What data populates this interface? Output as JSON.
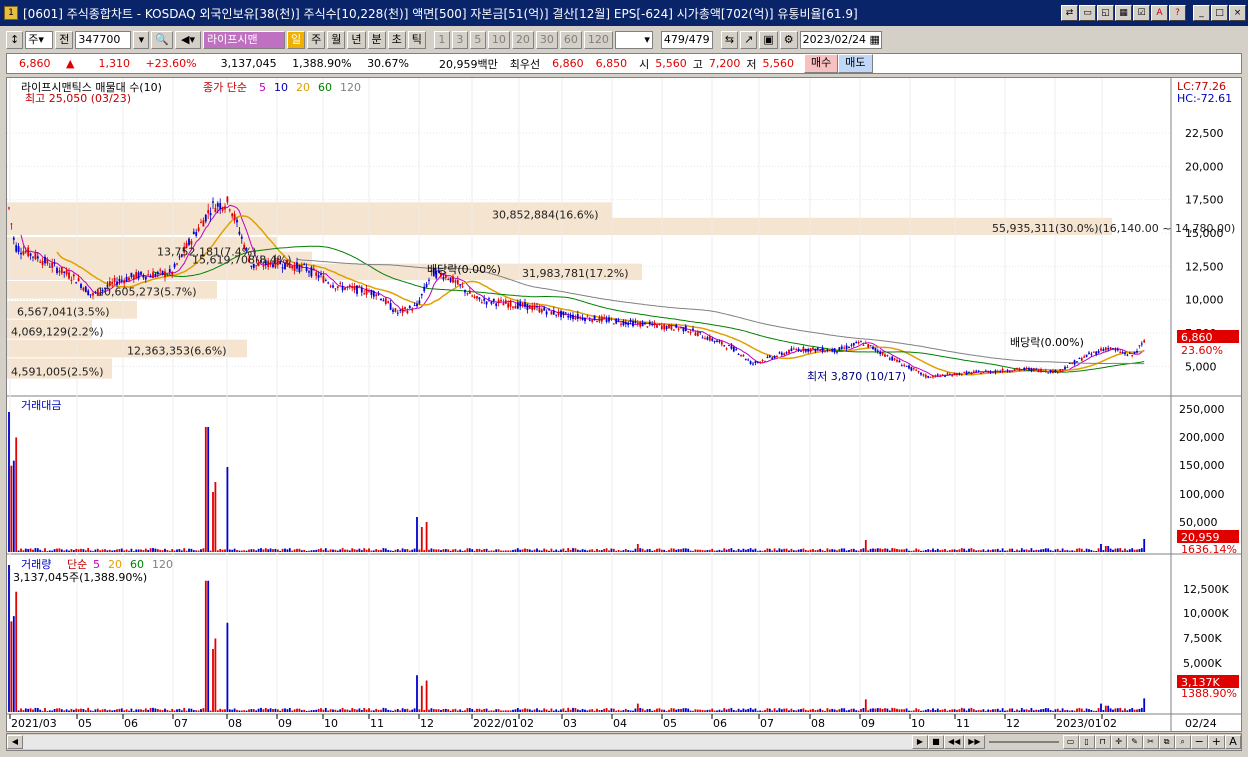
{
  "window": {
    "title": "[0601] 주식종합차트 - KOSDAQ 외국인보유[38(천)] 주식수[10,228(천)] 액면[500] 자본금[51(억)] 결산[12월] EPS[-624] 시가총액[702(억)] 유통비율[61.9]"
  },
  "toolbar": {
    "market": "주",
    "prev_label": "전",
    "code": "347700",
    "stock_name": "라이프시맨",
    "period_buttons": [
      "일",
      "주",
      "월",
      "년",
      "분",
      "초",
      "틱"
    ],
    "interval_buttons": [
      "1",
      "3",
      "5",
      "10",
      "20",
      "30",
      "60",
      "120"
    ],
    "count": "479",
    "count_total": "/479",
    "date": "2023/02/24"
  },
  "quote": {
    "price": "6,860",
    "arrow": "▲",
    "change": "1,310",
    "change_pct": "+23.60%",
    "volume": "3,137,045",
    "volume_pct": "1,388.90%",
    "turnover": "30.67%",
    "amount": "20,959백만",
    "best_label": "최우선",
    "ask": "6,860",
    "bid": "6,850",
    "open_label": "시",
    "open": "5,560",
    "high_label": "고",
    "high": "7,200",
    "low_label": "저",
    "low": "5,560",
    "buy_label": "매수",
    "sell_label": "매도"
  },
  "price_panel": {
    "legend_title": "라이프시맨틱스 매물대 수(10)",
    "ma_label": "종가 단순",
    "ma_periods": [
      "5",
      "10",
      "20",
      "60",
      "120"
    ],
    "ma_colors": [
      "#c000c0",
      "#0000c0",
      "#e0a000",
      "#008000",
      "#808080"
    ],
    "high_note": "최고 25,050 (03/23)",
    "low_note": "최저 3,870 (10/17)",
    "lc": "LC:77.26",
    "hc": "HC:-72.61",
    "current_price": "6,860",
    "current_pct": "23.60%",
    "div_label": "배당락(0.00%)",
    "profile_labels": [
      "30,852,884(16.6%)",
      "55,935,311(30.0%)(16,140.00 ~ 14,780.00)",
      "13,752,181(7.4%)",
      "15,619,708(8.4%)",
      "31,983,781(17.2%)",
      "10,605,273(5.7%)",
      "6,567,041(3.5%)",
      "4,069,129(2.2%)",
      "12,363,353(6.6%)",
      "4,591,005(2.5%)"
    ],
    "y_ticks": [
      "22,500",
      "20,000",
      "17,500",
      "15,000",
      "12,500",
      "10,000",
      "7,500",
      "5,000"
    ]
  },
  "amount_panel": {
    "title": "거래대금",
    "y_ticks": [
      "250,000",
      "200,000",
      "150,000",
      "100,000",
      "50,000"
    ],
    "current": "20,959",
    "current_pct": "1636.14%"
  },
  "volume_panel": {
    "title": "거래량",
    "ma_label": "단순",
    "ma_periods": [
      "5",
      "20",
      "60",
      "120"
    ],
    "value_note": "3,137,045주(1,388.90%)",
    "y_ticks": [
      "12,500K",
      "10,000K",
      "7,500K",
      "5,000K"
    ],
    "current": "3,137K",
    "current_pct": "1388.90%"
  },
  "x_axis": {
    "labels": [
      "2021/03",
      "05",
      "06",
      "07",
      "08",
      "09",
      "10",
      "11",
      "12",
      "2022/01",
      "02",
      "03",
      "04",
      "05",
      "06",
      "07",
      "08",
      "09",
      "10",
      "11",
      "12",
      "2023/01",
      "02"
    ],
    "end_label": "02/24"
  },
  "chart_data": {
    "type": "candlestick",
    "x": [
      "2021/03",
      "2021/05",
      "2021/06",
      "2021/07",
      "2021/08",
      "2021/09",
      "2021/10",
      "2021/11",
      "2021/12",
      "2022/01",
      "2022/02",
      "2022/03",
      "2022/04",
      "2022/05",
      "2022/06",
      "2022/07",
      "2022/08",
      "2022/09",
      "2022/10",
      "2022/11",
      "2022/12",
      "2023/01",
      "2023/02"
    ],
    "close_approx": [
      14000,
      10500,
      11500,
      12000,
      16500,
      12000,
      10500,
      9000,
      11500,
      10000,
      9500,
      8500,
      8000,
      7600,
      6800,
      5800,
      6200,
      6500,
      4300,
      4500,
      4800,
      5200,
      6860
    ],
    "ylim": [
      3000,
      25500
    ],
    "high": 25050,
    "high_date": "03/23",
    "low": 3870,
    "low_date": "10/17"
  }
}
